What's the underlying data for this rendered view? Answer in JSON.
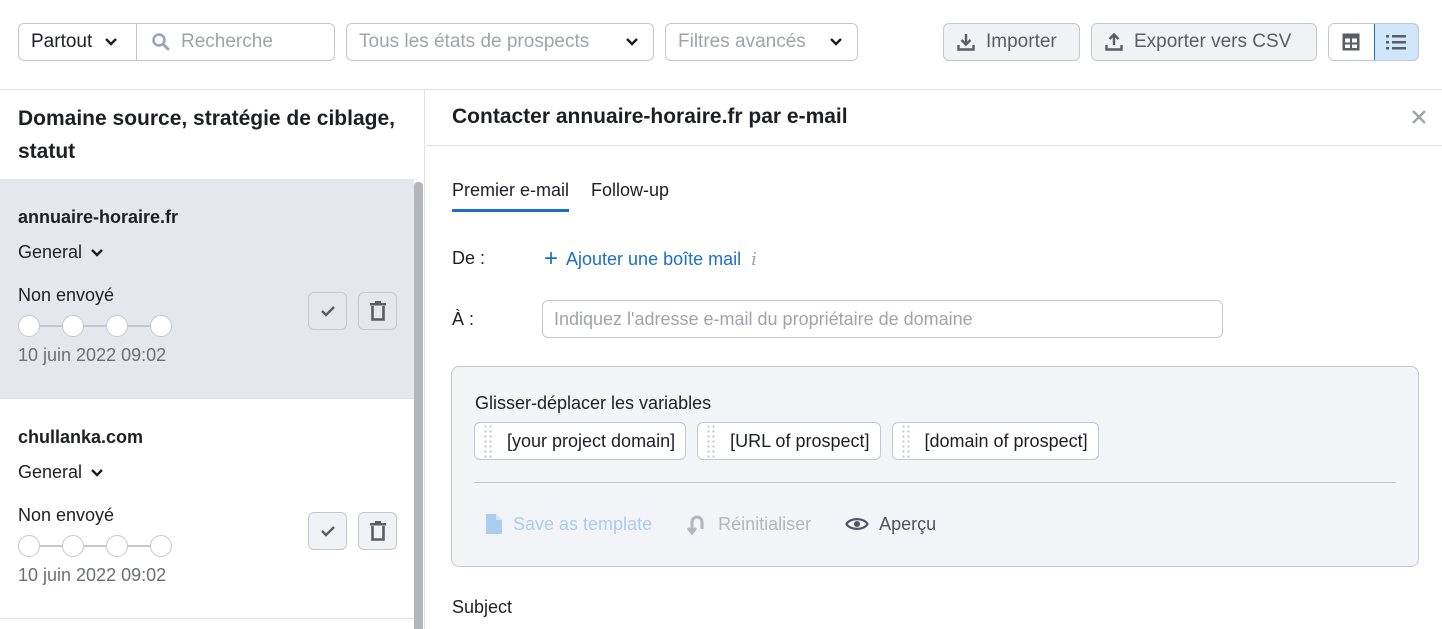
{
  "toolbar": {
    "scope_select": "Partout",
    "search_placeholder": "Recherche",
    "states_select": "Tous les états de prospects",
    "filters_select": "Filtres avancés",
    "import_label": "Importer",
    "export_label": "Exporter vers CSV",
    "view_modes": [
      {
        "name": "table-view",
        "active": false
      },
      {
        "name": "list-view",
        "active": true
      }
    ]
  },
  "left_panel": {
    "title": "Domaine source, stratégie de ciblage, statut",
    "prospects": [
      {
        "domain": "annuaire-horaire.fr",
        "strategy": "General",
        "status": "Non envoyé",
        "steps_total": 4,
        "steps_done": 0,
        "date": "10 juin 2022 09:02",
        "selected": true
      },
      {
        "domain": "chullanka.com",
        "strategy": "General",
        "status": "Non envoyé",
        "steps_total": 4,
        "steps_done": 0,
        "date": "10 juin 2022 09:02",
        "selected": false
      }
    ]
  },
  "right_panel": {
    "title": "Contacter annuaire-horaire.fr par e-mail",
    "tabs": [
      {
        "label": "Premier e-mail",
        "active": true
      },
      {
        "label": "Follow-up",
        "active": false
      }
    ],
    "from_label": "De :",
    "add_mailbox_label": "Ajouter une boîte mail",
    "info_glyph": "i",
    "to_label": "À :",
    "to_value": "",
    "to_placeholder": "Indiquez l'adresse e-mail du propriétaire de domaine",
    "variables": {
      "title": "Glisser-déplacer les variables",
      "chips": [
        "[your project domain]",
        "[URL of prospect]",
        "[domain of prospect]"
      ]
    },
    "actions": {
      "save_template": "Save as template",
      "reset": "Réinitialiser",
      "preview": "Aperçu"
    },
    "subject_label": "Subject"
  },
  "colors": {
    "accent": "#1b6fc9",
    "selected_row_bg": "#e6e7ed",
    "panel_bg": "#f3f4f8",
    "border": "#c4c7cf",
    "muted_text": "#a0a3ad"
  }
}
